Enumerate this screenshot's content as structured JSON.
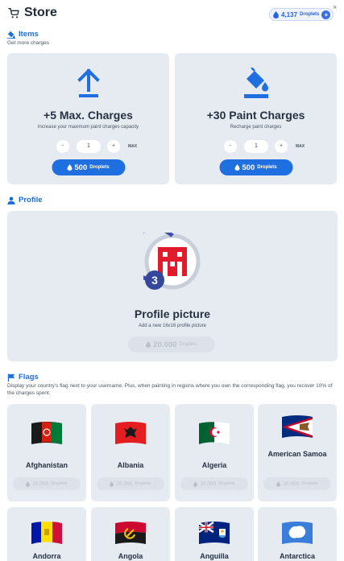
{
  "header": {
    "title": "Store",
    "droplets_amount": "4,137",
    "droplets_label": "Droplets",
    "add_label": "+",
    "close_label": "×"
  },
  "items_section": {
    "title": "Items",
    "subtitle": "Get more charges",
    "cards": [
      {
        "title": "+5 Max. Charges",
        "description": "Increase your maximum paint charges capacity",
        "minus": "-",
        "quantity": "1",
        "plus": "+",
        "max_label": "MAX",
        "price": "500",
        "price_label": "Droplets",
        "icon": "upload-arrow-icon"
      },
      {
        "title": "+30 Paint Charges",
        "description": "Recharge paint charges",
        "minus": "-",
        "quantity": "1",
        "plus": "+",
        "max_label": "MAX",
        "price": "500",
        "price_label": "Droplets",
        "icon": "paint-bucket-icon"
      }
    ]
  },
  "profile_section": {
    "title": "Profile",
    "card": {
      "title": "Profile picture",
      "description": "Add a new 16x16 profile picture",
      "level_badge": "3",
      "price": "20.000",
      "price_label": "Droplets"
    }
  },
  "flags_section": {
    "title": "Flags",
    "subtitle": "Display your country's flag next to your username. Plus, when painting in regions where you own the corresponding flag, you recover 10% of the charges spent.",
    "flags": [
      {
        "name": "Afghanistan",
        "price": "20.000",
        "price_label": "Droplets"
      },
      {
        "name": "Albania",
        "price": "20.000",
        "price_label": "Droplets"
      },
      {
        "name": "Algeria",
        "price": "20.000",
        "price_label": "Droplets"
      },
      {
        "name": "American Samoa",
        "price": "20.000",
        "price_label": "Droplets"
      },
      {
        "name": "Andorra"
      },
      {
        "name": "Angola"
      },
      {
        "name": "Anguilla"
      },
      {
        "name": "Antarctica"
      }
    ]
  },
  "colors": {
    "accent": "#1f6fe0",
    "card_bg": "#e6ebf2",
    "title_text": "#273142"
  }
}
